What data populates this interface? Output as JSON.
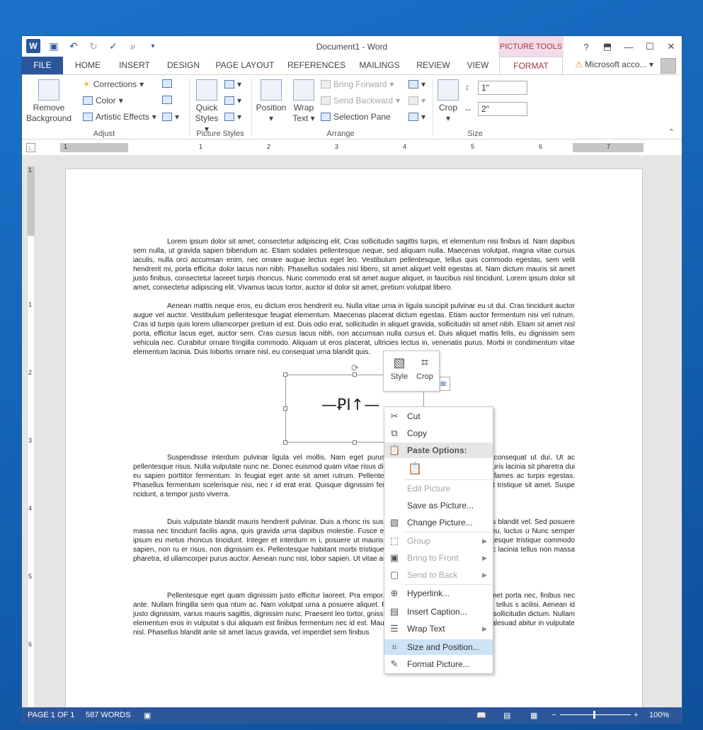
{
  "window": {
    "title": "Document1 - Word",
    "picture_tools": "PICTURE TOOLS",
    "account": "Microsoft acco..."
  },
  "tabs": [
    "FILE",
    "HOME",
    "INSERT",
    "DESIGN",
    "PAGE LAYOUT",
    "REFERENCES",
    "MAILINGS",
    "REVIEW",
    "VIEW",
    "FORMAT"
  ],
  "ribbon": {
    "adjust": {
      "remove_background": "Remove Background",
      "corrections": "Corrections",
      "color": "Color",
      "artistic_effects": "Artistic Effects",
      "label": "Adjust"
    },
    "picture_styles": {
      "quick_styles": "Quick Styles",
      "label": "Picture Styles"
    },
    "arrange": {
      "position": "Position",
      "wrap_text": "Wrap Text",
      "bring_forward": "Bring Forward",
      "send_backward": "Send Backward",
      "selection_pane": "Selection Pane",
      "label": "Arrange"
    },
    "size": {
      "crop": "Crop",
      "height": "1\"",
      "width": "2\"",
      "label": "Size"
    }
  },
  "ruler": {
    "marks": [
      "1",
      "1",
      "2",
      "3",
      "4",
      "5",
      "6",
      "7"
    ],
    "vmarks": [
      "1",
      "1",
      "2",
      "3",
      "4",
      "5",
      "6"
    ]
  },
  "document": {
    "p1": "Lorem ipsum dolor sit amet, consectetur adipiscing elit. Cras sollicitudin sagittis turpis, et elementum nisi finibus id. Nam dapibus sem nulla, ut gravida sapien bibendum ac. Etiam sodales pellentesque neque, sed aliquam nulla. Maecenas volutpat, magna vitae cursus iaculis, nulla orci accumsan enim, nec ornare augue lectus eget leo. Vestibulum pellentesque, tellus quis commodo egestas, sem velit hendrerit mi, porta efficitur dolor lacus non nibh. Phasellus sodales nisl libero, sit amet aliquet velit egestas at. Nam dictum mauris sit amet justo finibus, consectetur laoreet turpis rhoncus. Nunc commodo erat sit amet augue aliquet, in faucibus nisl tincidunt. Lorem ipsum dolor sit amet, consectetur adipiscing elit. Vivamus lacus tortor, auctor id dolor sit amet, pretium volutpat libero.",
    "p2": "Aenean mattis neque eros, eu dictum eros hendrerit eu. Nulla vitae urna in ligula suscipit pulvinar eu ut dui. Cras tincidunt auctor augue vel auctor. Vestibulum pellentesque feugiat elementum. Maecenas placerat dictum egestas. Etiam auctor fermentum nisi vel rutrum. Cras id turpis quis lorem ullamcorper pretium id est. Duis odio erat, sollicitudin in aliquet gravida, sollicitudin sit amet nibh. Etiam sit amet nisl porta, efficitur lacus eget, auctor sem. Cras cursus lacus nibh, non accumsan nulla cursus et. Duis aliquet mattis felis, eu dignissim sem vehicula nec. Curabitur ornare fringilla commodo. Aliquam ut eros placerat, ultricies lectus in, venenatis purus. Morbi in condimentum vitae elementum lacinia. Duis lobortis ornare nisl, eu consequat urna blandit quis.",
    "p3": "Suspendisse interdum pulvinar ligula vel mollis. Nam eget purus tincidunt eget varius sit amet, consequat ut dui. Ut ac pellentesque risus. Nulla vulputate nunc ne. Donec euismod quam vitae risus dictum, sed mollis felis convallis. Mauris lacinia sit pharetra dui eu sapien porttitor fermentum. In feugiat eget ante sit amet rutrum. Pellentesque h s et netus et malesuada fames ac turpis egestas. Phasellus fermentum scelerisque nisi, nec r id erat erat. Quisque dignissim fermentum dolor, ultricies congue est tristique sit amet. Suspe ncidunt, a tempor justo viverra.",
    "p4": "Duis vulputate blandit mauris hendrerit pulvinar. Duis a rhonc ris suscipit tristique ex, sed semper metus blandit vel. Sed posuere massa nec tincidunt facilis agna, quis gravida urna dapibus molestie. Fusce eget nisi sollicitudin, eleifend urna eu, luctus u Nunc semper ipsum eu metus rhoncus tincidunt. Integer et interdum m i, posuere ut mauris in, interdum aliquet purus. Pellentesque tristique commodo sapien, non ru er risus, non dignissim ex. Pellentesque habitant morbi tristique senectus et netus et malesu Nunc lacinia tellus non massa pharetra, id ullamcorper purus auctor. Aenean nunc nisl, lobor sapien. Ut vitae augue elit.",
    "p5": "Pellentesque eget quam dignissim justo efficitur laoreet. Pra empor. In sapien tortor, vestibulum sit amet porta nec, finibus nec ante. Nullam fringilla sem qua ntum ac. Nam volutpat urna a posuere aliquet. Fusce sed nulla commodo, semper tellus s acilisi. Aenean id justo dignissim, varius mauris sagittis, dignissim nunc. Praesent leo tortor, gnissim erat. Fusce id enim sit amet elit sollicitudin dictum. Nullam elementum eros in vulputat s dui aliquam est finibus fermentum nec id est. Mauris consectetur diam turpis, non malesuad abitur in vulputate nisl. Phasellus blandit ante sit amet lacus gravida, vel imperdiet sem finibus",
    "image_text": "—ꝐI↑—"
  },
  "mini_toolbar": {
    "style": "Style",
    "crop": "Crop"
  },
  "context_menu": {
    "cut": "Cut",
    "copy": "Copy",
    "paste_options": "Paste Options:",
    "edit_picture": "Edit Picture",
    "save_as_picture": "Save as Picture...",
    "change_picture": "Change Picture...",
    "group": "Group",
    "bring_to_front": "Bring to Front",
    "send_to_back": "Send to Back",
    "hyperlink": "Hyperlink...",
    "insert_caption": "Insert Caption...",
    "wrap_text": "Wrap Text",
    "size_and_position": "Size and Position...",
    "format_picture": "Format Picture..."
  },
  "status": {
    "page": "PAGE 1 OF 1",
    "words": "587 WORDS",
    "zoom": "100%"
  }
}
